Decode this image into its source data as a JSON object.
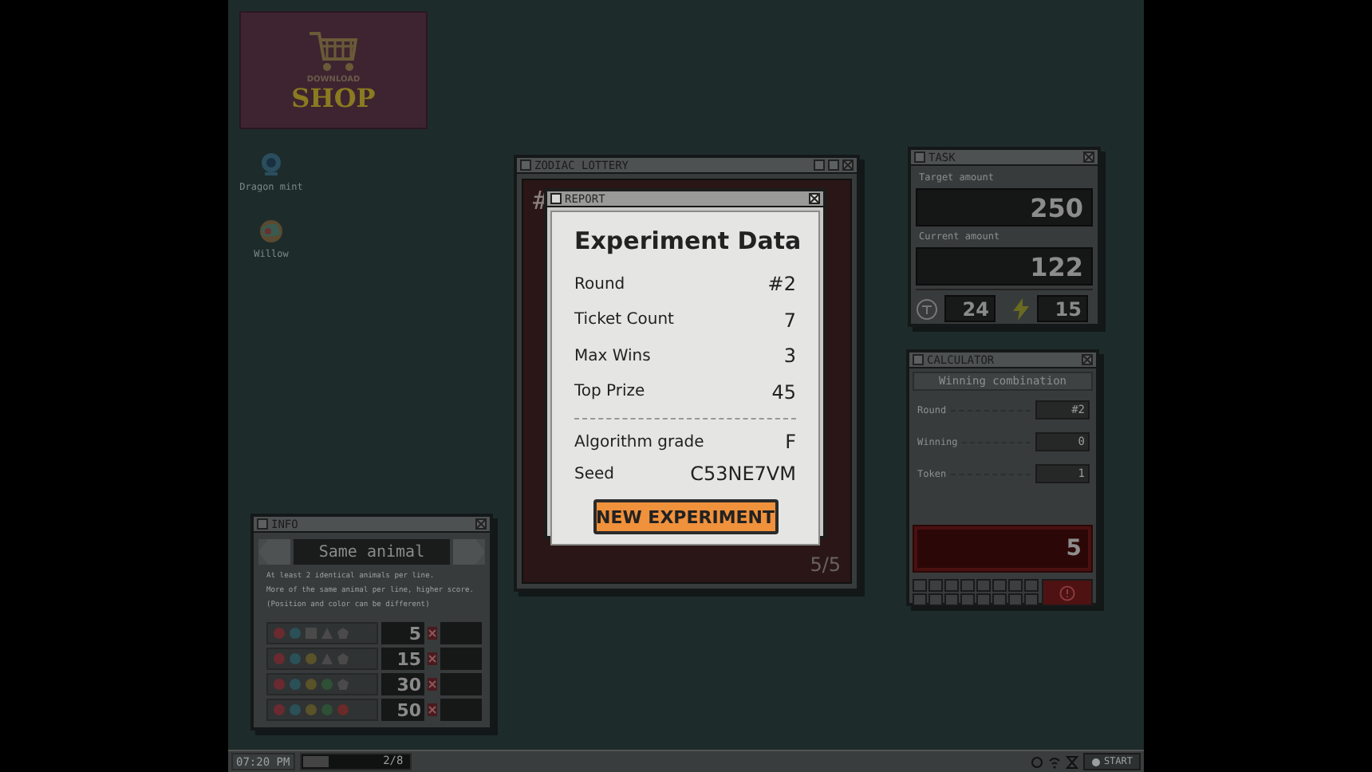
{
  "shop_banner": {
    "caption": "DOWNLOAD",
    "title": "SHOP"
  },
  "desktop_icons": [
    {
      "label": "Dragon mint",
      "kind": "globe"
    },
    {
      "label": "Willow",
      "kind": "ball"
    }
  ],
  "lottery_window": {
    "title": "ZODIAC LOTTERY",
    "number_prefix": "#",
    "page": "5/5"
  },
  "report": {
    "title": "REPORT",
    "heading": "Experiment Data",
    "rows": [
      {
        "label": "Round",
        "value": "#2"
      },
      {
        "label": "Ticket Count",
        "value": "7"
      },
      {
        "label": "Max Wins",
        "value": "3"
      },
      {
        "label": "Top Prize",
        "value": "45"
      }
    ],
    "grade_rows": [
      {
        "label": "Algorithm grade",
        "value": "F"
      },
      {
        "label": "Seed",
        "value": "C53NE7VM"
      }
    ],
    "button": "NEW EXPERIMENT"
  },
  "task_window": {
    "title": "TASK",
    "target_label": "Target amount",
    "target": "250",
    "current_label": "Current amount",
    "current": "122",
    "tickets": "24",
    "energy": "15"
  },
  "calculator": {
    "title": "CALCULATOR",
    "header": "Winning combination",
    "rows": [
      {
        "label": "Round",
        "value": "#2"
      },
      {
        "label": "Winning",
        "value": "0"
      },
      {
        "label": "Token",
        "value": "1"
      }
    ],
    "result": "5"
  },
  "info": {
    "title": "INFO",
    "heading": "Same animal",
    "lines": [
      "At least 2 identical animals per line.",
      "More of the same animal per line, higher score.",
      "(Position and color can be different)"
    ],
    "rows": [
      {
        "score": "5",
        "symbols": [
          {
            "kind": "circle",
            "color": "#6a2a30"
          },
          {
            "kind": "circle",
            "color": "#2a5058"
          },
          {
            "kind": "square",
            "color": "#4a4a4a"
          },
          {
            "kind": "triangle",
            "color": "#4a4a4a"
          },
          {
            "kind": "pentagon",
            "color": "#4a4a4a"
          }
        ]
      },
      {
        "score": "15",
        "symbols": [
          {
            "kind": "circle",
            "color": "#6a2a30"
          },
          {
            "kind": "circle",
            "color": "#2a5058"
          },
          {
            "kind": "circle",
            "color": "#5a5228"
          },
          {
            "kind": "triangle",
            "color": "#4a4a4a"
          },
          {
            "kind": "pentagon",
            "color": "#4a4a4a"
          }
        ]
      },
      {
        "score": "30",
        "symbols": [
          {
            "kind": "circle",
            "color": "#6a2a30"
          },
          {
            "kind": "circle",
            "color": "#2a5058"
          },
          {
            "kind": "circle",
            "color": "#5a5228"
          },
          {
            "kind": "circle",
            "color": "#2e5036"
          },
          {
            "kind": "pentagon",
            "color": "#4a4a4a"
          }
        ]
      },
      {
        "score": "50",
        "symbols": [
          {
            "kind": "circle",
            "color": "#6a2a30"
          },
          {
            "kind": "circle",
            "color": "#2a5058"
          },
          {
            "kind": "circle",
            "color": "#5a5228"
          },
          {
            "kind": "circle",
            "color": "#2e5036"
          },
          {
            "kind": "circle",
            "color": "#6a2a28"
          }
        ]
      }
    ]
  },
  "taskbar": {
    "time": "07:20 PM",
    "progress_label": "2/8",
    "level": 0.25,
    "start": "START"
  }
}
